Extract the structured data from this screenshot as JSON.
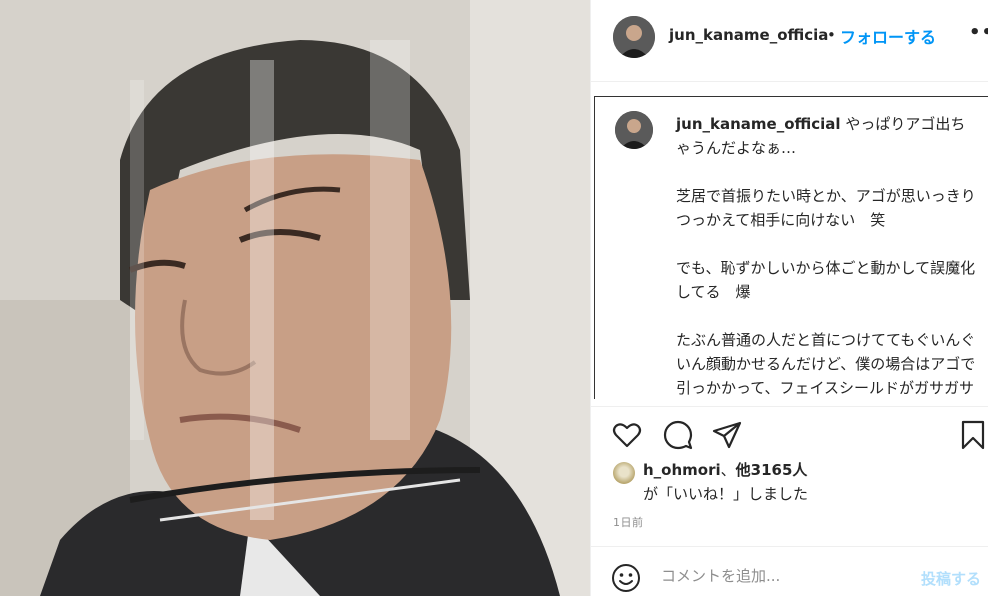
{
  "post": {
    "username": "jun_kaname_officia",
    "separator": "•",
    "follow_label": "フォローする",
    "more_label": "•••"
  },
  "caption": {
    "username": "jun_kaname_official",
    "line1": "やっぱりアゴ出ちゃうんだよなぁ…",
    "para2": "芝居で首振りたい時とか、アゴが思いっきりつっかえて相手に向けない　笑",
    "para3": "でも、恥ずかしいから体ごと動かして誤魔化してる　爆",
    "para4": "たぶん普通の人だと首につけててもぐいんぐいん顔動かせるんだけど、僕の場合はアゴで引っかかって、フェイスシールドがガサガサ音がして恥ずかし"
  },
  "actions": {
    "icons": [
      "heart-icon",
      "comment-icon",
      "share-icon",
      "save-icon"
    ]
  },
  "likes": {
    "liker": "h_ohmori",
    "sep": "、",
    "others": "他3165人",
    "suffix": "が「いいね！」しました"
  },
  "timestamp": "1日前",
  "comment_box": {
    "placeholder": "コメントを追加...",
    "post_label": "投稿する"
  },
  "colors": {
    "accent": "#0095f6",
    "post_disabled": "#b2dffc",
    "secondary_text": "#8e8e8e"
  }
}
